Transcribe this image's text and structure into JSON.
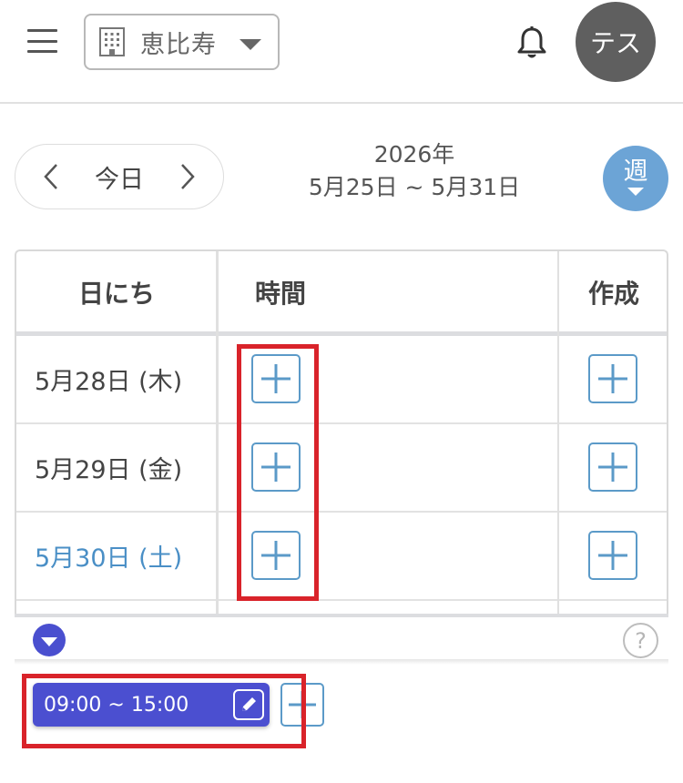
{
  "header": {
    "location": "恵比寿",
    "avatar_text": "テス"
  },
  "nav": {
    "today_label": "今日",
    "year": "2026年",
    "range": "5月25日 ~ 5月31日",
    "view_label": "週"
  },
  "table": {
    "columns": [
      "日にち",
      "時間",
      "作成"
    ],
    "rows": [
      {
        "date": "5月28日 (木)"
      },
      {
        "date": "5月29日 (金)"
      },
      {
        "date": "5月30日 (土)",
        "weekend": true
      }
    ]
  },
  "schedule": {
    "time_chip": "09:00 ~ 15:00"
  },
  "help_label": "?",
  "colors": {
    "accent_blue": "#5b9ac8",
    "saturday_blue": "#4a8fc6",
    "indigo": "#4b4fd0",
    "avatar_gray": "#5f5f5f",
    "annotation_red": "#d9232a"
  }
}
